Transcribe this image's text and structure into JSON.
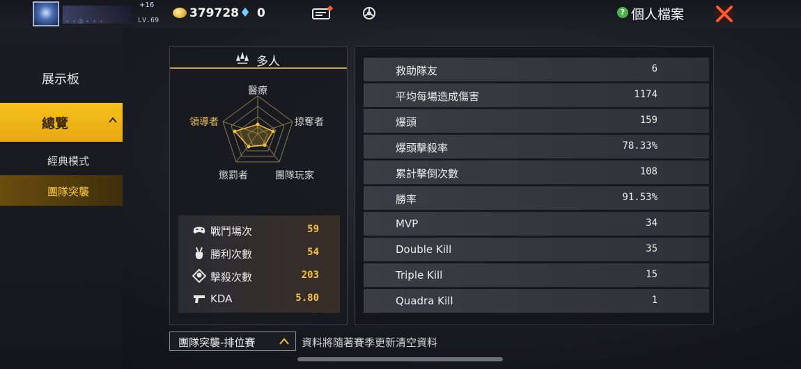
{
  "topbar": {
    "level_badge": "+16",
    "level": "LV.69",
    "name_text": "・・⑦・・・",
    "coins": "379728",
    "diamonds": "0",
    "title": "個人檔案",
    "help_icon": "?"
  },
  "sidebar": {
    "showcase": "展示板",
    "overview": "總覽",
    "classic": "經典模式",
    "team_raid": "團隊突襲"
  },
  "mode_card": {
    "title": "多人",
    "radar_labels": {
      "top": "醫療",
      "right": "掠奪者",
      "bottom_right": "團隊玩家",
      "bottom_left": "懲罰者",
      "left": "領導者"
    },
    "stats": [
      {
        "label": "戰鬥場次",
        "value": "59"
      },
      {
        "label": "勝利次數",
        "value": "54"
      },
      {
        "label": "擊殺次數",
        "value": "203"
      },
      {
        "label": "KDA",
        "value": "5.80"
      }
    ]
  },
  "detail_table": [
    {
      "label": "救助隊友",
      "value": "6"
    },
    {
      "label": "平均每場造成傷害",
      "value": "1174"
    },
    {
      "label": "爆頭",
      "value": "159"
    },
    {
      "label": "爆頭擊殺率",
      "value": "78.33%"
    },
    {
      "label": "累計擊倒次數",
      "value": "108"
    },
    {
      "label": "勝率",
      "value": "91.53%"
    },
    {
      "label": "MVP",
      "value": "34"
    },
    {
      "label": "Double Kill",
      "value": "35"
    },
    {
      "label": "Triple Kill",
      "value": "15"
    },
    {
      "label": "Quadra Kill",
      "value": "1"
    }
  ],
  "footer": {
    "rank_select": "團隊突襲-排位賽",
    "note": "資料將隨著賽季更新清空資料"
  },
  "colors": {
    "accent": "#f6c01d",
    "value_gold": "#f4c23e",
    "close": "#ff5a2a"
  }
}
